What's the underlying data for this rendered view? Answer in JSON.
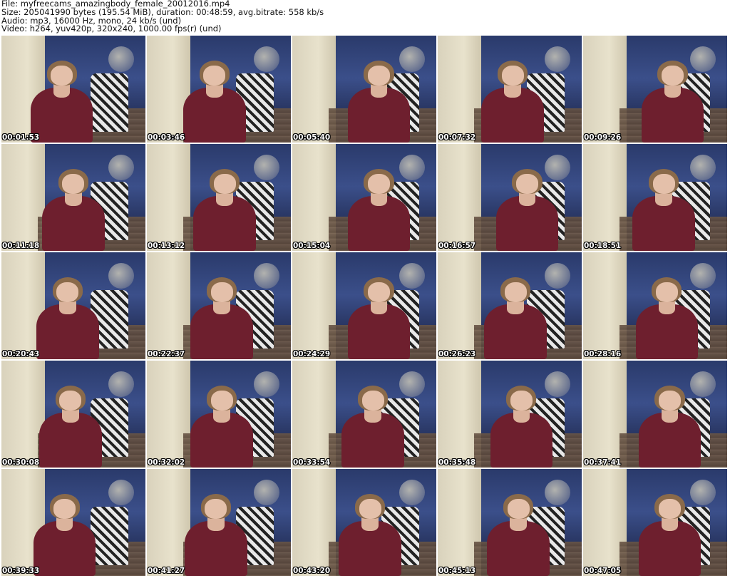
{
  "header": {
    "file_line": "File: myfreecams_amazingbody_female_20012016.mp4",
    "size_line": "Size: 205041990 bytes (195.54 MiB), duration: 00:48:59, avg.bitrate: 558 kb/s",
    "audio_line": "Audio: mp3, 16000 Hz, mono, 24 kb/s (und)",
    "video_line": "Video: h264, yuv420p, 320x240, 1000.00 fps(r) (und)"
  },
  "thumbnails": [
    {
      "timestamp": "00:01:53"
    },
    {
      "timestamp": "00:03:46"
    },
    {
      "timestamp": "00:05:40"
    },
    {
      "timestamp": "00:07:32"
    },
    {
      "timestamp": "00:09:26"
    },
    {
      "timestamp": "00:11:18"
    },
    {
      "timestamp": "00:13:12"
    },
    {
      "timestamp": "00:15:04"
    },
    {
      "timestamp": "00:16:57"
    },
    {
      "timestamp": "00:18:51"
    },
    {
      "timestamp": "00:20:43"
    },
    {
      "timestamp": "00:22:37"
    },
    {
      "timestamp": "00:24:29"
    },
    {
      "timestamp": "00:26:23"
    },
    {
      "timestamp": "00:28:16"
    },
    {
      "timestamp": "00:30:08"
    },
    {
      "timestamp": "00:32:02"
    },
    {
      "timestamp": "00:33:54"
    },
    {
      "timestamp": "00:35:48"
    },
    {
      "timestamp": "00:37:41"
    },
    {
      "timestamp": "00:39:33"
    },
    {
      "timestamp": "00:41:27"
    },
    {
      "timestamp": "00:43:20"
    },
    {
      "timestamp": "00:45:13"
    },
    {
      "timestamp": "00:47:05"
    }
  ]
}
